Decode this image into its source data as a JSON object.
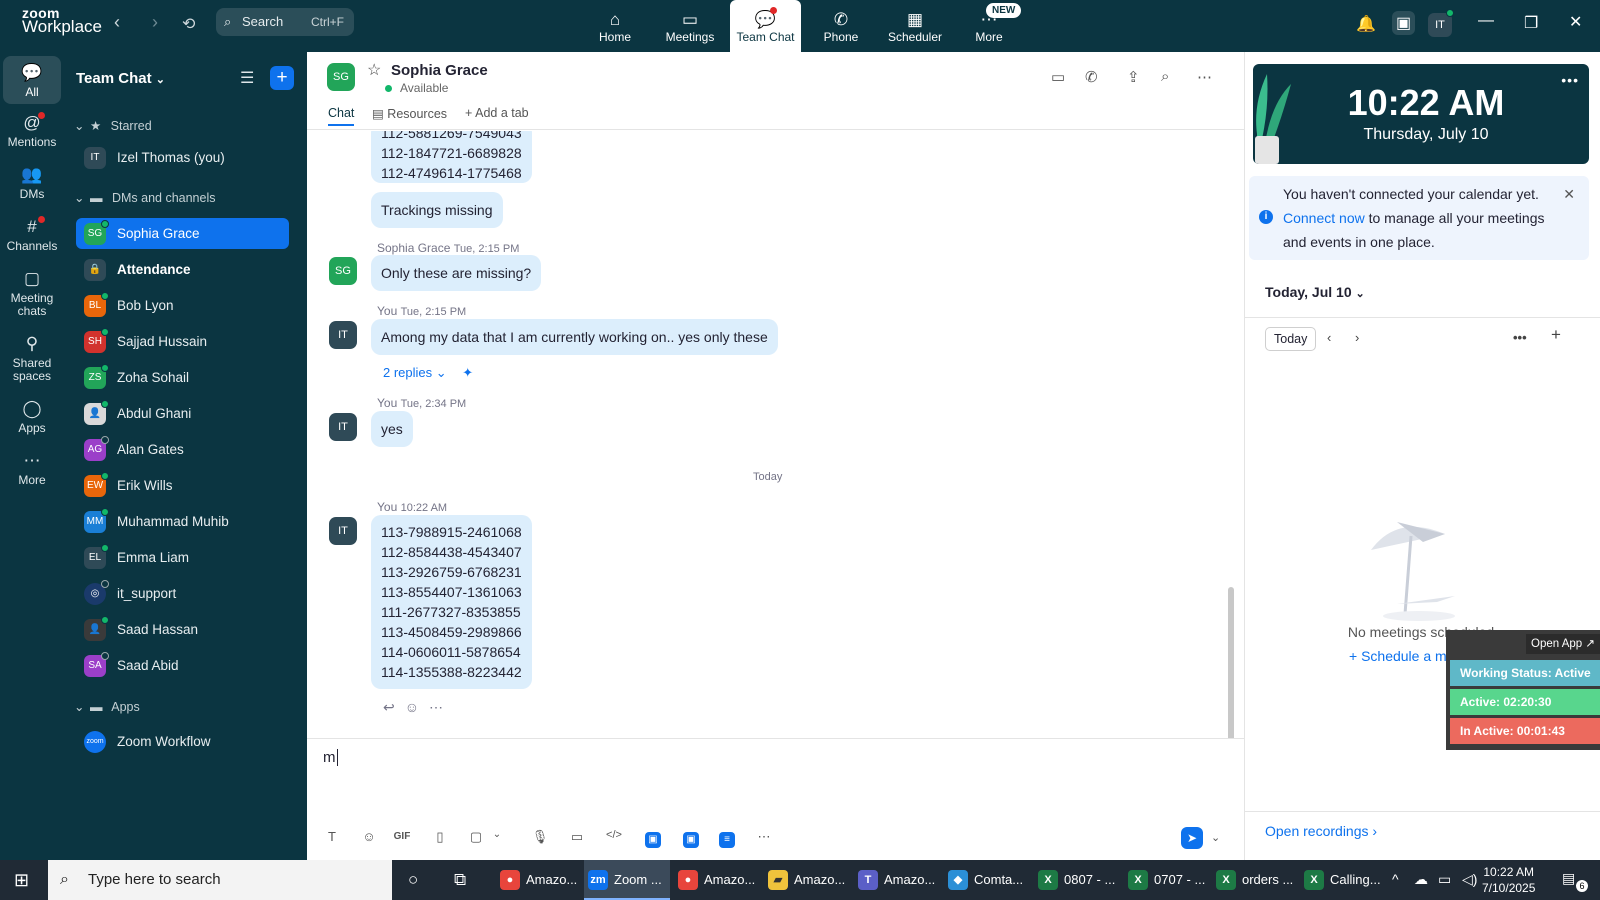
{
  "app": {
    "logo_line1": "zoom",
    "logo_line2": "Workplace",
    "search_label": "Search",
    "search_shortcut": "Ctrl+F",
    "tabs": [
      {
        "label": "Home",
        "icon": "home-icon"
      },
      {
        "label": "Meetings",
        "icon": "video-icon"
      },
      {
        "label": "Team Chat",
        "icon": "chat-icon"
      },
      {
        "label": "Phone",
        "icon": "phone-icon"
      },
      {
        "label": "Scheduler",
        "icon": "calendar-icon"
      },
      {
        "label": "More",
        "icon": "more-icon"
      }
    ],
    "new_badge": "NEW",
    "user_initials": "IT",
    "accent": "#0e72ed",
    "nav_bg": "#0b3541"
  },
  "rail": [
    {
      "label": "All",
      "icon": "chat-icon"
    },
    {
      "label": "Mentions",
      "icon": "at-icon"
    },
    {
      "label": "DMs",
      "icon": "users-icon"
    },
    {
      "label": "Channels",
      "icon": "hash-icon"
    },
    {
      "label": "Meeting chats",
      "icon": "meeting-chat-icon"
    },
    {
      "label": "Shared spaces",
      "icon": "shared-space-icon"
    },
    {
      "label": "Apps",
      "icon": "apps-icon"
    },
    {
      "label": "More",
      "icon": "more-icon"
    }
  ],
  "sidebar": {
    "title": "Team Chat",
    "starred_label": "Starred",
    "starred": [
      {
        "initials": "IT",
        "name": "Izel Thomas (you)",
        "color": "#2f4a57"
      }
    ],
    "dms_label": "DMs and channels",
    "dms": [
      {
        "initials": "SG",
        "name": "Sophia Grace",
        "color": "#22a559",
        "presence": "online"
      },
      {
        "initials": "",
        "name": "Attendance",
        "color": "#2f4a57",
        "presence": "none"
      },
      {
        "initials": "BL",
        "name": "Bob Lyon",
        "color": "#e8660a",
        "presence": "online"
      },
      {
        "initials": "SH",
        "name": "Sajjad Hussain",
        "color": "#d2322d",
        "presence": "online"
      },
      {
        "initials": "ZS",
        "name": "Zoha Sohail",
        "color": "#22a559",
        "presence": "online"
      },
      {
        "initials": "",
        "name": "Abdul Ghani",
        "color": "#6b6b6b",
        "presence": "online"
      },
      {
        "initials": "AG",
        "name": "Alan Gates",
        "color": "#9b3fc9",
        "presence": "offline"
      },
      {
        "initials": "EW",
        "name": "Erik Wills",
        "color": "#e8660a",
        "presence": "online"
      },
      {
        "initials": "MM",
        "name": "Muhammad Muhib",
        "color": "#1a7fd6",
        "presence": "online"
      },
      {
        "initials": "EL",
        "name": "Emma Liam",
        "color": "#2f4a57",
        "presence": "online"
      },
      {
        "initials": "",
        "name": "it_support",
        "color": "#1a3a6b",
        "presence": "offline"
      },
      {
        "initials": "",
        "name": "Saad Hassan",
        "color": "#3a3a3a",
        "presence": "online"
      },
      {
        "initials": "SA",
        "name": "Saad Abid",
        "color": "#9b3fc9",
        "presence": "offline"
      }
    ],
    "apps_label": "Apps",
    "apps": [
      {
        "initials": "zoom",
        "name": "Zoom Workflow",
        "color": "#0e72ed"
      }
    ]
  },
  "chat": {
    "contact_initials": "SG",
    "contact_name": "Sophia Grace",
    "contact_status": "Available",
    "tabs": [
      "Chat",
      "Resources",
      "Add a tab"
    ],
    "top_block": [
      "112-5881269-7549043",
      "112-1847721-6689828",
      "112-4749614-1775468"
    ],
    "trackings": "Trackings missing",
    "m1": {
      "author": "Sophia Grace",
      "time": "Tue, 2:15 PM",
      "text": "Only these are missing?",
      "initials": "SG"
    },
    "m2": {
      "author": "You",
      "time": "Tue, 2:15 PM",
      "text": "Among my data that I am currently working on.. yes only these",
      "initials": "IT",
      "replies": "2 replies"
    },
    "m3": {
      "author": "You",
      "time": "Tue, 2:34 PM",
      "text": "yes",
      "initials": "IT"
    },
    "divider": "Today",
    "m4": {
      "author": "You",
      "time": "10:22 AM",
      "initials": "IT",
      "lines": [
        "113-7988915-2461068",
        "112-8584438-4543407",
        "113-2926759-6768231",
        "113-8554407-1361063",
        "111-2677327-8353855",
        "113-4508459-2989866",
        "114-0606011-5878654",
        "114-1355388-8223442"
      ]
    },
    "composer_value": "m"
  },
  "right": {
    "time": "10:22 AM",
    "date": "Thursday, July 10",
    "notice_pre": "You haven't connected your calendar yet.",
    "notice_link": "Connect now",
    "notice_post": "to manage all your meetings and events in one place.",
    "today_heading": "Today, Jul 10",
    "today_button": "Today",
    "no_meetings": "No meetings scheduled.",
    "schedule_link": "Schedule a meeting",
    "open_recordings": "Open recordings"
  },
  "widget": {
    "open_app": "Open App",
    "working": "Working Status: Active",
    "active": "Active: 02:20:30",
    "inactive": "In Active: 00:01:43",
    "colors": {
      "working": "#5fb8c8",
      "active": "#58d68d",
      "inactive": "#ec6a5e"
    }
  },
  "taskbar": {
    "search_placeholder": "Type here to search",
    "apps": [
      {
        "label": "Amazo...",
        "icon": "chrome-icon"
      },
      {
        "label": "Zoom ...",
        "icon": "zoom-icon"
      },
      {
        "label": "Amazo...",
        "icon": "chrome-icon"
      },
      {
        "label": "Amazo...",
        "icon": "folder-icon"
      },
      {
        "label": "Amazo...",
        "icon": "teams-icon"
      },
      {
        "label": "Comta...",
        "icon": "app-icon"
      },
      {
        "label": "0807 - ...",
        "icon": "excel-icon"
      },
      {
        "label": "0707 - ...",
        "icon": "excel-icon"
      },
      {
        "label": "orders ...",
        "icon": "excel-icon"
      },
      {
        "label": "Calling...",
        "icon": "excel-icon"
      }
    ],
    "time": "10:22 AM",
    "date": "7/10/2025",
    "notif_count": "6"
  }
}
